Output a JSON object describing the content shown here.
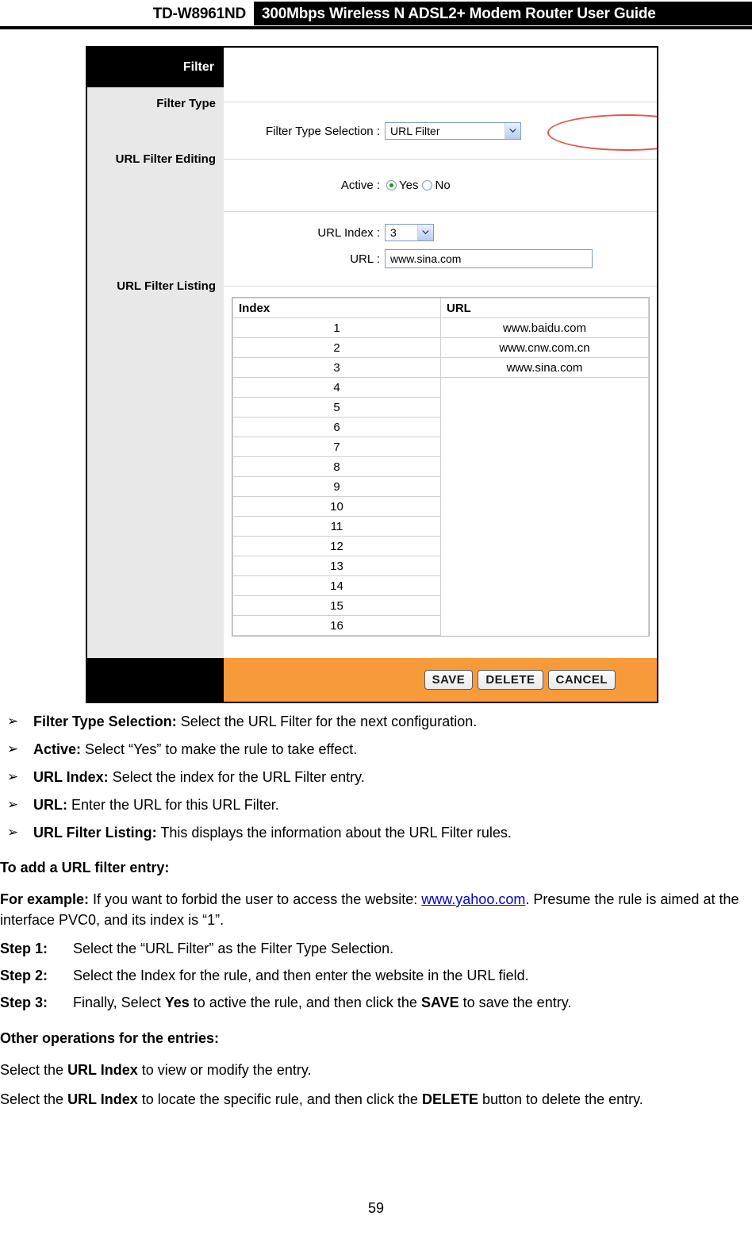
{
  "header": {
    "model": "TD-W8961ND",
    "title": "300Mbps Wireless N ADSL2+ Modem Router User Guide"
  },
  "screenshot": {
    "panel_title": "Filter",
    "sidebar_sections": [
      {
        "label": "Filter Type"
      },
      {
        "label": "URL Filter Editing"
      },
      {
        "label": "URL Filter Listing"
      }
    ],
    "fields": {
      "filter_type_label": "Filter Type Selection :",
      "filter_type_value": "URL Filter",
      "active_label": "Active :",
      "active_yes": "Yes",
      "active_no": "No",
      "active_selected": "Yes",
      "url_index_label": "URL Index :",
      "url_index_value": "3",
      "url_label": "URL :",
      "url_value": "www.sina.com"
    },
    "listing": {
      "columns": [
        "Index",
        "URL"
      ],
      "rows": [
        {
          "index": "1",
          "url": "www.baidu.com"
        },
        {
          "index": "2",
          "url": "www.cnw.com.cn"
        },
        {
          "index": "3",
          "url": "www.sina.com"
        },
        {
          "index": "4",
          "url": ""
        },
        {
          "index": "5",
          "url": ""
        },
        {
          "index": "6",
          "url": ""
        },
        {
          "index": "7",
          "url": ""
        },
        {
          "index": "8",
          "url": ""
        },
        {
          "index": "9",
          "url": ""
        },
        {
          "index": "10",
          "url": ""
        },
        {
          "index": "11",
          "url": ""
        },
        {
          "index": "12",
          "url": ""
        },
        {
          "index": "13",
          "url": ""
        },
        {
          "index": "14",
          "url": ""
        },
        {
          "index": "15",
          "url": ""
        },
        {
          "index": "16",
          "url": ""
        }
      ]
    },
    "buttons": {
      "save": "SAVE",
      "delete": "DELETE",
      "cancel": "CANCEL"
    },
    "colors": {
      "footer_accent": "#f79b3a",
      "header_bar": "#000000",
      "sidebar": "#e8e8e8",
      "highlight_ellipse": "#e4554d",
      "radio_selected": "#169416"
    }
  },
  "prose": {
    "bullet_marker": "➢",
    "bullets": [
      {
        "term": "Filter Type Selection:",
        "text": " Select the URL Filter for the next configuration."
      },
      {
        "term": "Active:",
        "text": " Select “Yes” to make the rule to take effect."
      },
      {
        "term": "URL Index:",
        "text": " Select the index for the URL Filter entry."
      },
      {
        "term": "URL:",
        "text": " Enter the URL for this URL Filter."
      },
      {
        "term": "URL Filter Listing:",
        "text": " This displays the information about the URL Filter rules."
      }
    ],
    "add_entry_heading": "To add a URL filter entry:",
    "example": {
      "term": "For example:",
      "text_before": " If you want to forbid the user to access the website: ",
      "link": "www.yahoo.com",
      "text_after": ". Presume the rule is aimed at the interface PVC0, and its index is “1”."
    },
    "steps": [
      {
        "label": "Step 1:",
        "pre": "Select the “URL Filter” as the Filter Type Selection.",
        "bold": "",
        "post": ""
      },
      {
        "label": "Step 2:",
        "pre": "Select the Index for the rule, and then enter the website in the URL field.",
        "bold": "",
        "post": ""
      },
      {
        "label": "Step 3:",
        "pre": "Finally, Select ",
        "bold": "Yes",
        "post": " to active the rule, and then click the "
      }
    ],
    "step3_bold2": "SAVE",
    "step3_tail": " to save the entry.",
    "other_ops_heading": "Other operations for the entries:",
    "other_ops": [
      {
        "pre": "Select the ",
        "bold": "URL Index",
        "post": " to view or modify the entry."
      },
      {
        "pre": "Select the ",
        "bold": "URL Index",
        "post": " to locate the specific rule, and then click the ",
        "bold2": "DELETE",
        "post2": " button to delete the entry."
      }
    ]
  },
  "page_number": "59"
}
